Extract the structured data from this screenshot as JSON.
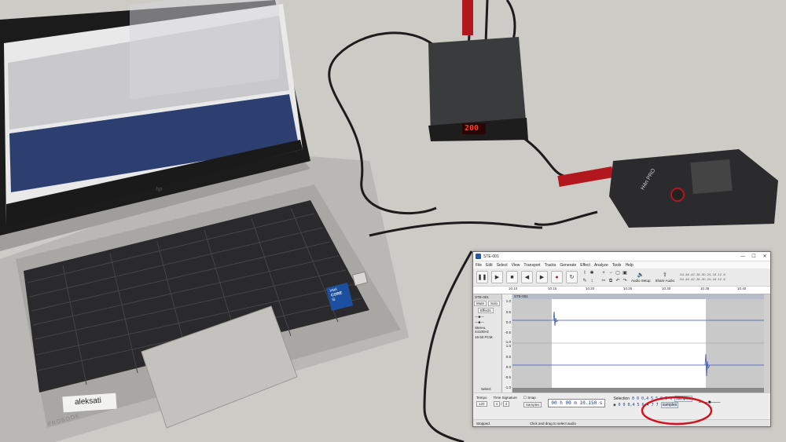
{
  "laptop": {
    "brand_logo": "hp",
    "badge_top": "intel",
    "badge_core": "CORE",
    "badge_gen": "i5",
    "sticker": "aleksati",
    "series": "PROBOOK"
  },
  "interface_box": {
    "display": "200"
  },
  "recorder": {
    "label": "H4n PRO"
  },
  "audacity": {
    "window_title": "STE-001",
    "window_controls": [
      "—",
      "☐",
      "✕"
    ],
    "menu": [
      "File",
      "Edit",
      "Select",
      "View",
      "Transport",
      "Tracks",
      "Generate",
      "Effect",
      "Analyze",
      "Tools",
      "Help"
    ],
    "toolbar": {
      "audio_setup": "Audio Setup",
      "share_audio": "Share Audio",
      "meter_ticks": "-54 -48 -42 -36 -30 -24 -18 -12 -6"
    },
    "ruler_ticks": [
      "10.10",
      "10.15",
      "10.20",
      "10.25",
      "10.30",
      "10.35",
      "10.40"
    ],
    "track": {
      "name": "STE-001",
      "clip_name": "STE-001",
      "mute": "Mute",
      "solo": "Solo",
      "effects": "Effects",
      "info_line1": "Stereo, 44100Hz",
      "info_line2": "16-bit PCM",
      "select": "Select",
      "scale_top": [
        "1.0",
        "0.5",
        "0.0",
        "-0.5",
        "-1.0"
      ],
      "scale_bottom": [
        "1.0",
        "0.5",
        "0.0",
        "-0.5",
        "-1.0"
      ]
    },
    "bottom": {
      "tempo_label": "Tempo",
      "tempo_value": "120",
      "time_sig_label": "Time Signature",
      "time_sig_num": "4",
      "time_sig_den": "4",
      "snap_label": "Snap",
      "snap_unit": "Samples",
      "time_display": "00 h 00 m 10.150 s",
      "selection_label": "Selection",
      "selection_start": "0 0 0,4 5 5,9 5 6",
      "selection_end": "0 0 0,4 5 6,4 7 7",
      "selection_unit": "samples"
    },
    "status": {
      "left": "Stopped.",
      "middle": "Click and drag to select audio"
    }
  }
}
